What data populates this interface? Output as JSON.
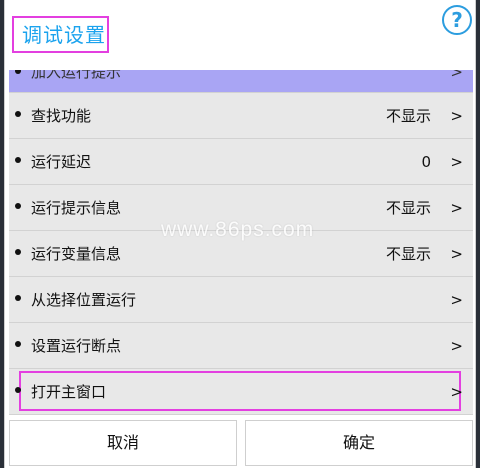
{
  "dialog": {
    "title": "调试设置",
    "help_icon": "?"
  },
  "items": [
    {
      "label": "加入运行提示",
      "value": "",
      "chevron": ">"
    },
    {
      "label": "查找功能",
      "value": "不显示",
      "chevron": ">"
    },
    {
      "label": "运行延迟",
      "value": "0",
      "chevron": ">"
    },
    {
      "label": "运行提示信息",
      "value": "不显示",
      "chevron": ">"
    },
    {
      "label": "运行变量信息",
      "value": "不显示",
      "chevron": ">"
    },
    {
      "label": "从选择位置运行",
      "value": "",
      "chevron": ">"
    },
    {
      "label": "设置运行断点",
      "value": "",
      "chevron": ">"
    },
    {
      "label": "打开主窗口",
      "value": "",
      "chevron": ">"
    }
  ],
  "buttons": {
    "cancel": "取消",
    "ok": "确定"
  },
  "watermark": "www.86ps.com",
  "colors": {
    "title": "#1ba3ee",
    "highlight_border": "#e33fe0",
    "selected_row": "#a9a5f4"
  }
}
